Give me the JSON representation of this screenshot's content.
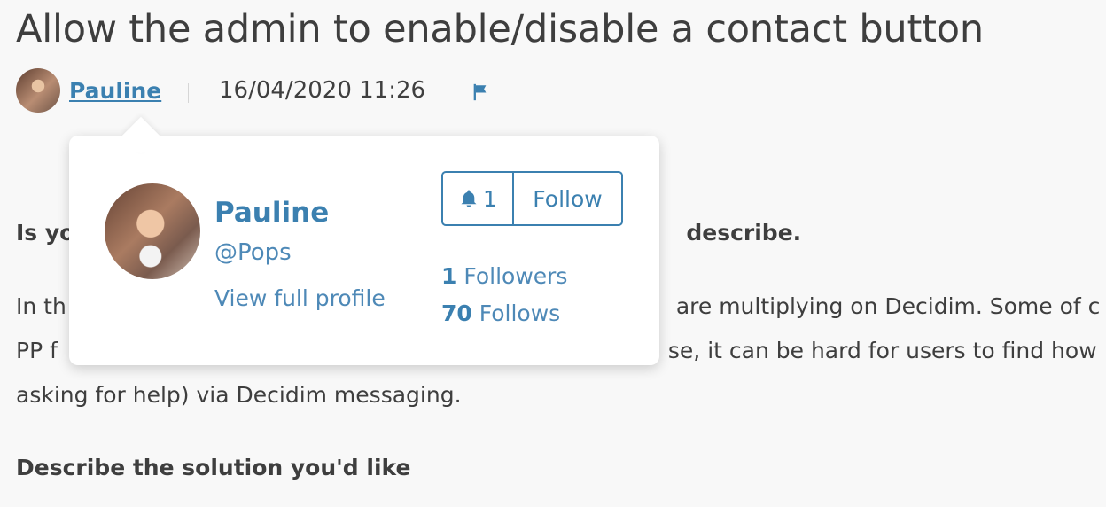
{
  "page": {
    "title": "Allow the admin to enable/disable a contact button"
  },
  "author": {
    "name": "Pauline",
    "datetime": "16/04/2020 11:26"
  },
  "body": {
    "line1": "Is yo",
    "line1b": "describe.",
    "line2": "In th",
    "line2b": "are multiplying on Decidim. Some of c",
    "line3": "PP f",
    "line3b": "se, it can be hard for users to find how",
    "line4": "asking for help) via Decidim messaging.",
    "line5": "Describe the solution you'd like"
  },
  "profile_card": {
    "name": "Pauline",
    "handle": "@Pops",
    "view_profile": "View full profile",
    "notify_count": "1",
    "follow_label": "Follow",
    "followers_count": "1",
    "followers_label": "Followers",
    "follows_count": "70",
    "follows_label": "Follows"
  },
  "icons": {
    "flag": "flag-icon",
    "bell": "bell-icon"
  },
  "colors": {
    "accent": "#3b80b0",
    "text": "#3e3e3e",
    "background": "#f8f8f8"
  }
}
